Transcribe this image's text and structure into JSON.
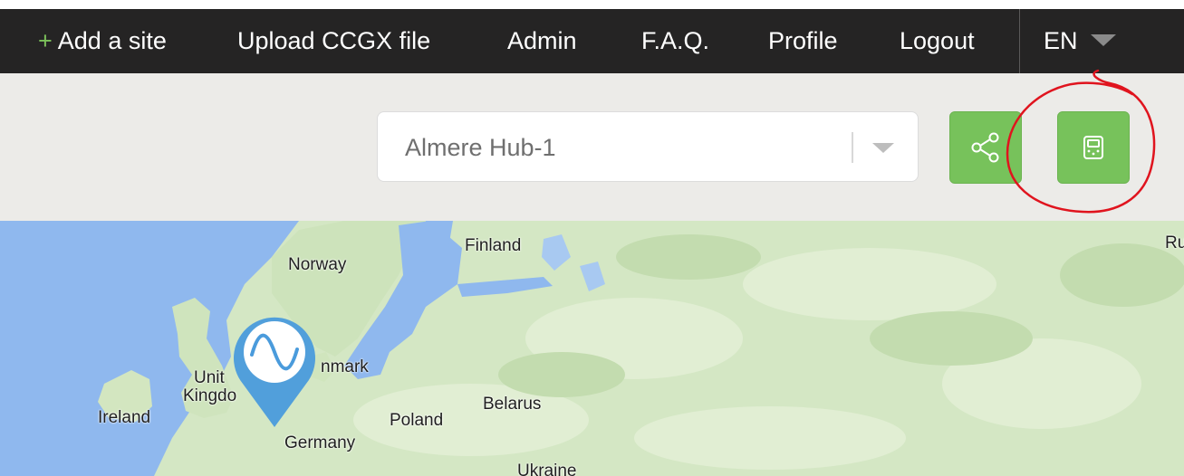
{
  "nav": {
    "add_site_plus": "+",
    "add_site": "Add a site",
    "upload": "Upload CCGX file",
    "admin": "Admin",
    "faq": "F.A.Q.",
    "profile": "Profile",
    "logout": "Logout",
    "language": "EN"
  },
  "toolbar": {
    "site_select_value": "Almere Hub-1",
    "share_icon": "share-icon",
    "device_icon": "device-icon"
  },
  "map": {
    "labels": {
      "finland": "Finland",
      "norway": "Norway",
      "russia_partial": "Ru",
      "denmark_partial": "nmark",
      "united_partial": "Unit",
      "kingdom_partial": "Kingdo",
      "ireland": "Ireland",
      "belarus": "Belarus",
      "poland": "Poland",
      "germany": "Germany",
      "ukraine": "Ukraine"
    },
    "marker_icon": "sine-wave-marker-icon"
  },
  "colors": {
    "nav_bg": "#252424",
    "toolbar_bg": "#ecebe8",
    "accent_green": "#77c25b",
    "plus_green": "#7cc15a",
    "sea": "#8ab4f8",
    "land": "#d2e6c2",
    "marker_blue": "#4a9bdc",
    "annotation_red": "#e0141e"
  }
}
